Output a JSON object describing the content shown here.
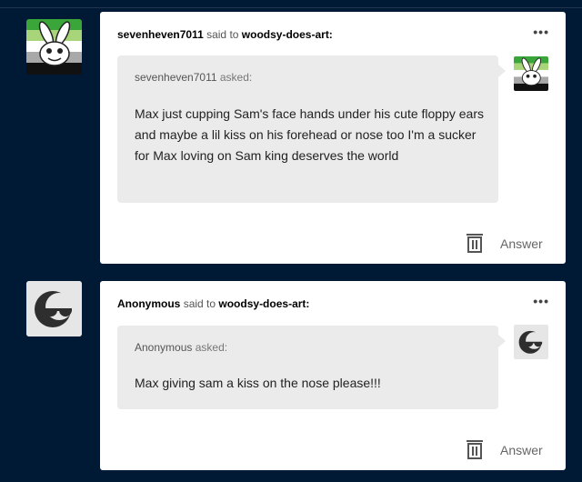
{
  "posts": [
    {
      "author": "sevenheven7011",
      "said_to": "said to",
      "recipient": "woodsy-does-art:",
      "more": "•••",
      "asker": "sevenheven7011",
      "asked": "asked:",
      "question": "Max just cupping Sam's face hands under his cute floppy ears and maybe a lil kiss on his forehead or nose too I'm a sucker for Max loving on Sam king deserves the world",
      "answer_label": "Answer",
      "avatar_icon": "bunny-flag-avatar-icon"
    },
    {
      "author": "Anonymous",
      "said_to": "said to",
      "recipient": "woodsy-does-art:",
      "more": "•••",
      "asker": "Anonymous",
      "asked": "asked:",
      "question": "Max giving sam a kiss on the nose please!!!",
      "answer_label": "Answer",
      "avatar_icon": "anonymous-sunglasses-icon"
    }
  ],
  "colors": {
    "background": "#001935",
    "card": "#ffffff",
    "bubble": "#ebebeb",
    "flag_green_dark": "#3aa63a",
    "flag_green_light": "#a8d47a",
    "flag_grey": "#a9a9a9"
  }
}
